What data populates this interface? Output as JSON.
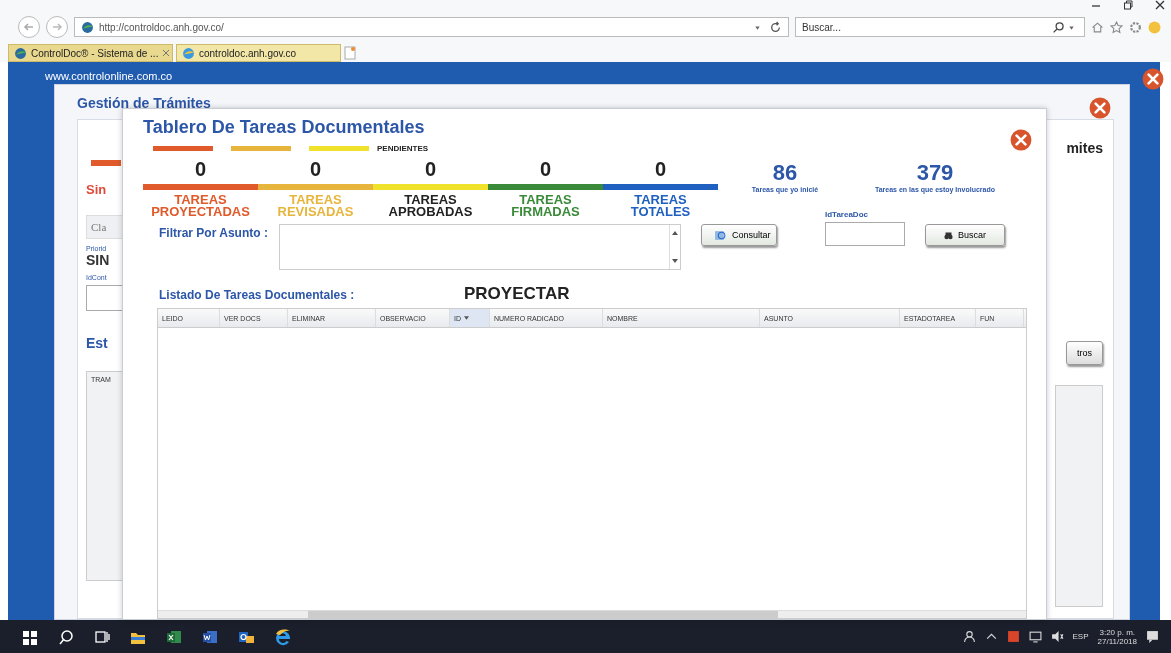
{
  "browser": {
    "address": "http://controldoc.anh.gov.co/",
    "search_placeholder": "Buscar...",
    "tabs": [
      {
        "label": "ControlDoc® - Sistema de ...",
        "selected": false
      },
      {
        "label": "controldoc.anh.gov.co",
        "selected": true
      }
    ]
  },
  "page": {
    "site_url": "www.controlonline.com.co"
  },
  "background_window": {
    "title": "Gestión de Trámites",
    "status_text": "Sin",
    "field_label": "Cla",
    "priority_label": "Priorid",
    "priority_value": "SIN",
    "id_label": "IdCont",
    "section_title": "Est",
    "table_header": "TRAM",
    "right_title": "mites",
    "right_button": "tros"
  },
  "dialog": {
    "title": "Tablero De Tareas Documentales",
    "pending": {
      "label": "PENDIENTES",
      "bars": [
        {
          "color": "#e05a2b"
        },
        {
          "color": "#e8b53c"
        },
        {
          "color": "#f0e12a"
        }
      ]
    },
    "stats": [
      {
        "count": "0",
        "label": "TAREAS\nPROYECTADAS",
        "color": "#e05a2b"
      },
      {
        "count": "0",
        "label": "TAREAS\nREVISADAS",
        "color": "#e8b53c"
      },
      {
        "count": "0",
        "label": "TAREAS\nAPROBADAS",
        "color": "#f0e12a"
      },
      {
        "count": "0",
        "label": "TAREAS\nFIRMADAS",
        "color": "#3a8a3a"
      },
      {
        "count": "0",
        "label": "TAREAS\nTOTALES",
        "color": "#2060c0"
      }
    ],
    "totals": [
      {
        "count": "86",
        "label": "Tareas que yo inicié"
      },
      {
        "count": "379",
        "label": "Tareas en las que estoy Involucrado"
      }
    ],
    "filter_label": "Filtrar Por Asunto :",
    "consult_button": "Consultar",
    "id_label": "IdTareaDoc",
    "search_button": "Buscar",
    "list_title": "Listado De Tareas Documentales :",
    "mode": "PROYECTAR",
    "columns": [
      {
        "label": "LEIDO",
        "sorted": false
      },
      {
        "label": "VER DOCS",
        "sorted": false
      },
      {
        "label": "ELIMINAR",
        "sorted": false
      },
      {
        "label": "OBSERVACIO",
        "sorted": false
      },
      {
        "label": "ID",
        "sorted": true
      },
      {
        "label": "NUMERO RADICADO",
        "sorted": false
      },
      {
        "label": "NOMBRE",
        "sorted": false
      },
      {
        "label": "ASUNTO",
        "sorted": false
      },
      {
        "label": "ESTADOTAREA",
        "sorted": false
      },
      {
        "label": "FUN",
        "sorted": false
      }
    ]
  },
  "taskbar": {
    "apps": [
      {
        "kind": "start"
      },
      {
        "kind": "search"
      },
      {
        "kind": "taskview"
      },
      {
        "kind": "explorer"
      },
      {
        "kind": "excel"
      },
      {
        "kind": "word"
      },
      {
        "kind": "outlook"
      },
      {
        "kind": "ie"
      }
    ],
    "language": "ESP",
    "time": "3:20 p. m.",
    "date": "27/11/2018"
  }
}
